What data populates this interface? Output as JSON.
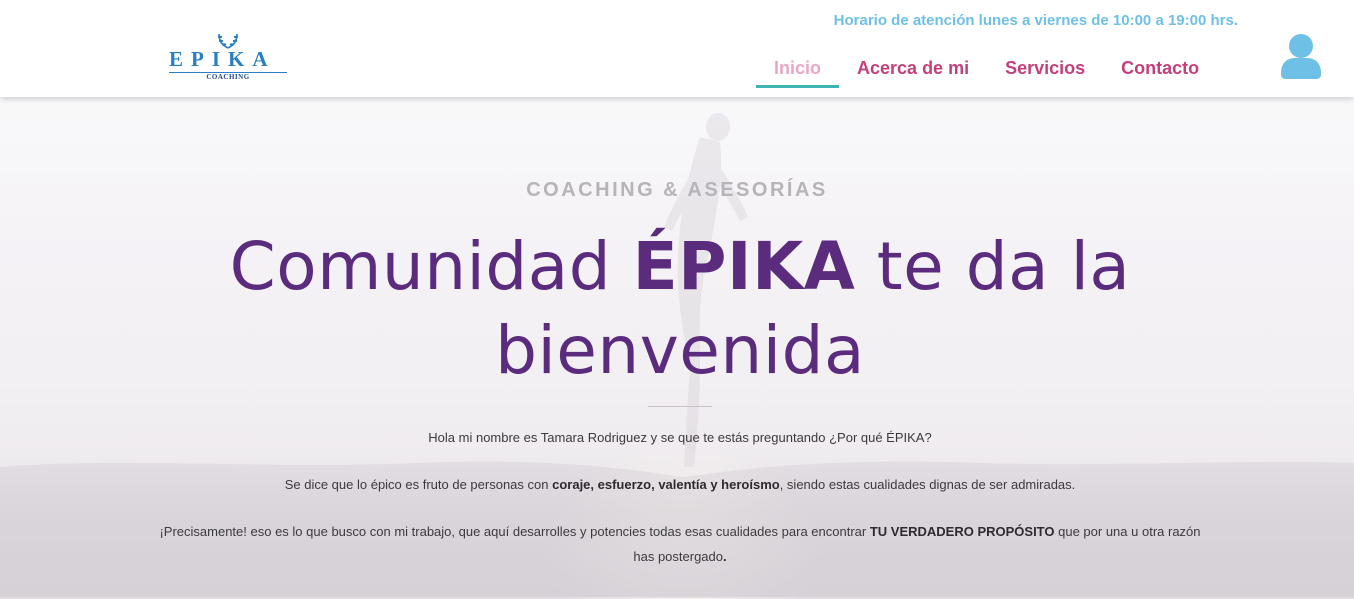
{
  "header": {
    "logo": {
      "word": "EPIKA",
      "sub": "COACHING"
    },
    "hours": "Horario de atención lunes a viernes de 10:00 a 19:00 hrs.",
    "nav": [
      {
        "label": "Inicio",
        "active": true
      },
      {
        "label": "Acerca de mi",
        "active": false
      },
      {
        "label": "Servicios",
        "active": false
      },
      {
        "label": "Contacto",
        "active": false
      }
    ],
    "user_icon": "user-icon"
  },
  "hero": {
    "kicker": "COACHING & ASESORÍAS",
    "title_pre": "Comunidad ",
    "title_bold": "ÉPIKA",
    "title_post": " te da la bienvenida",
    "p1": "Hola mi nombre es Tamara Rodriguez y se que te estás preguntando ¿Por qué ÉPIKA?",
    "p2_pre": "Se dice que lo épico es fruto de personas con ",
    "p2_bold": "coraje, esfuerzo, valentía y heroísmo",
    "p2_post": ", siendo estas cualidades dignas de ser admiradas.",
    "p3_pre": "¡Precisamente! eso es lo que busco con mi trabajo, que aquí desarrolles y potencies todas esas cualidades para encontrar ",
    "p3_bold": "TU VERDADERO PROPÓSITO",
    "p3_post": " que por una u otra razón has postergado",
    "p3_end": "."
  },
  "colors": {
    "nav_active": "#e9a7c5",
    "nav": "#c2407c",
    "underline": "#3fb5b3",
    "hours": "#6fc0e6",
    "title": "#5b2c7e",
    "user_icon": "#6fc0e6"
  }
}
